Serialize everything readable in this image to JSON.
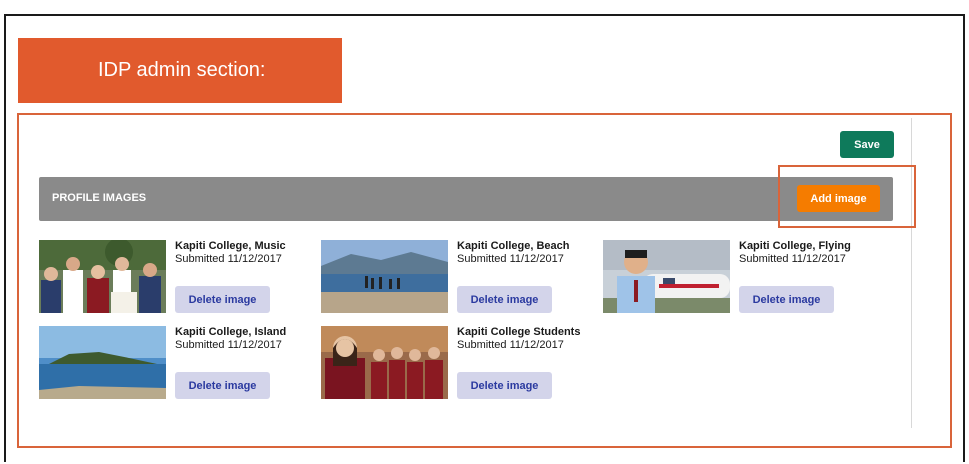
{
  "banner": {
    "title": "IDP admin section:"
  },
  "toolbar": {
    "save_label": "Save"
  },
  "profile_images": {
    "section_title": "PROFILE IMAGES",
    "add_label": "Add image",
    "items": [
      {
        "title": "Kapiti College, Music",
        "submitted": "Submitted 11/12/2017",
        "delete_label": "Delete image"
      },
      {
        "title": "Kapiti College, Beach",
        "submitted": "Submitted 11/12/2017",
        "delete_label": "Delete image"
      },
      {
        "title": "Kapiti College, Flying",
        "submitted": "Submitted 11/12/2017",
        "delete_label": "Delete image"
      },
      {
        "title": "Kapiti College, Island",
        "submitted": "Submitted 11/12/2017",
        "delete_label": "Delete image"
      },
      {
        "title": "Kapiti College Students",
        "submitted": "Submitted 11/12/2017",
        "delete_label": "Delete image"
      }
    ]
  },
  "colors": {
    "banner": "#e15a2d",
    "save_button": "#0e7a5b",
    "add_button": "#f57c00",
    "section_bar": "#8a8a8a",
    "delete_button": "#d3d4ea",
    "highlight_outline": "#d9643a"
  }
}
